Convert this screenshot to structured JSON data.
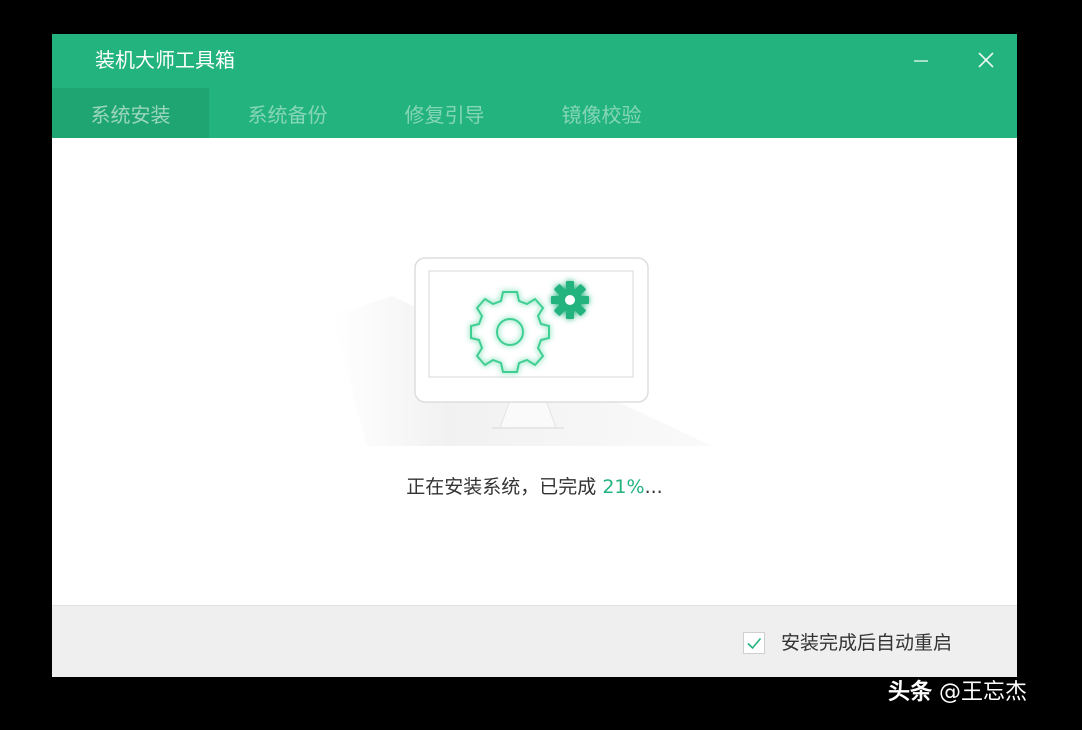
{
  "window": {
    "title": "装机大师工具箱"
  },
  "tabs": [
    {
      "label": "系统安装",
      "active": true
    },
    {
      "label": "系统备份",
      "active": false
    },
    {
      "label": "修复引导",
      "active": false
    },
    {
      "label": "镜像校验",
      "active": false
    }
  ],
  "status": {
    "prefix": "正在安装系统，已完成 ",
    "progress": "21%",
    "suffix": "...",
    "progress_value": 0.21
  },
  "footer": {
    "restart_label": "安装完成后自动重启",
    "restart_checked": true
  },
  "watermark": {
    "brand": "头条",
    "author": " @王忘杰"
  },
  "icons": {
    "minimize": "minimize-icon",
    "close": "close-icon",
    "checkbox": "checkmark-icon",
    "illustration": "monitor-gears-icon"
  },
  "colors": {
    "accent": "#22b37f",
    "accent_active_tab": "#1fa572",
    "footer_bg": "#efefef"
  }
}
